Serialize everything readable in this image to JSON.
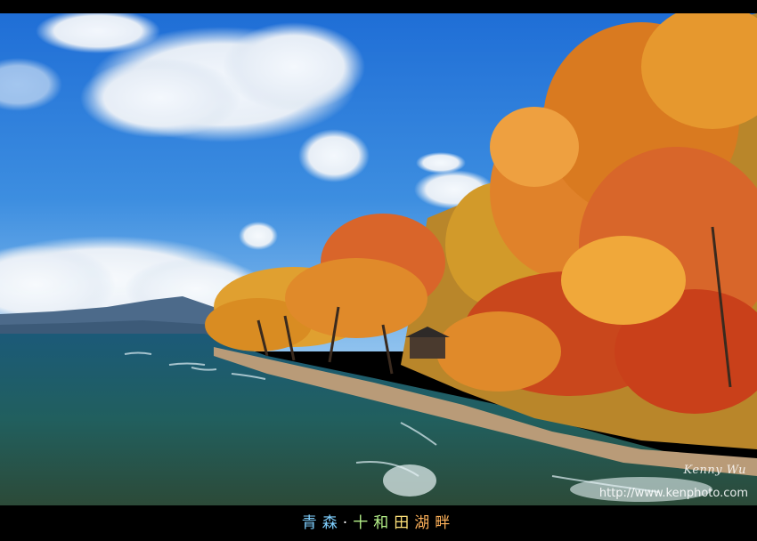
{
  "photo": {
    "description_colors": {
      "sky": "#2f7fd8",
      "foliage_orange": "#e07a1e",
      "foliage_red": "#c8401a",
      "water": "#1f5a6e"
    }
  },
  "watermark": {
    "signature": "Kenny Wu",
    "url": "http://www.kenphoto.com"
  },
  "caption": {
    "part1": "青森",
    "separator": "·",
    "part2": "十和",
    "part3": "田",
    "part4": "湖畔"
  }
}
